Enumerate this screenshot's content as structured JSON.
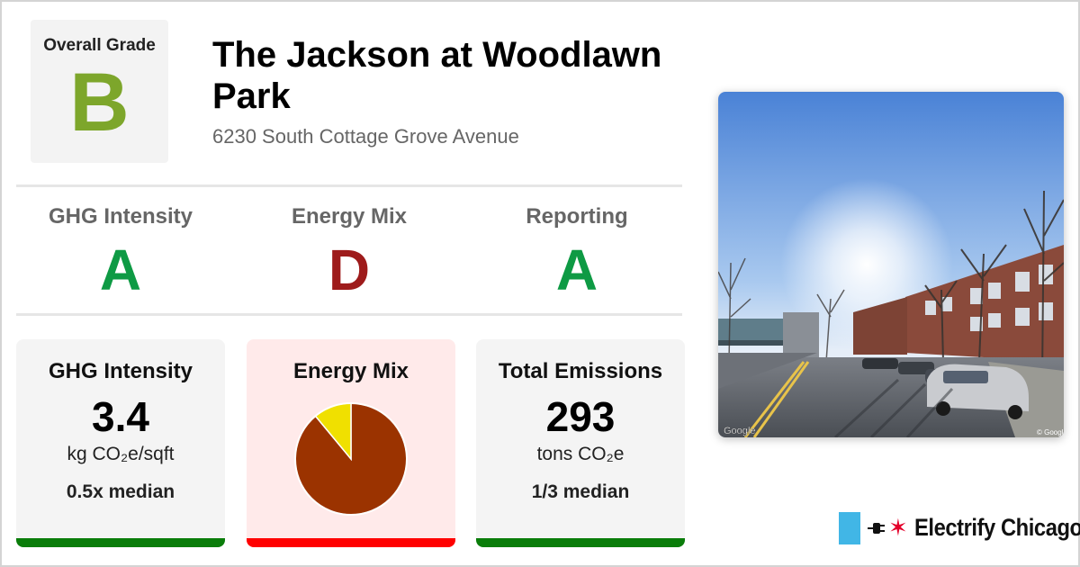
{
  "overall": {
    "label": "Overall Grade",
    "grade": "B",
    "color": "#7da62b"
  },
  "building": {
    "name": "The Jackson at Woodlawn Park",
    "address": "6230 South Cottage Grove Avenue"
  },
  "grades": [
    {
      "label": "GHG Intensity",
      "grade": "A",
      "color": "#0e9a44"
    },
    {
      "label": "Energy Mix",
      "grade": "D",
      "color": "#9e1b1b"
    },
    {
      "label": "Reporting",
      "grade": "A",
      "color": "#0e9a44"
    }
  ],
  "cards": {
    "ghg": {
      "title": "GHG Intensity",
      "value": "3.4",
      "unit": "kg CO₂e/sqft",
      "median": "0.5x median",
      "bar_color": "#0a7d0a"
    },
    "mix": {
      "title": "Energy Mix",
      "bar_color": "#ff0000"
    },
    "emissions": {
      "title": "Total Emissions",
      "value": "293",
      "unit": "tons CO₂e",
      "median": "1/3 median",
      "bar_color": "#0a7d0a"
    }
  },
  "chart_data": {
    "type": "pie",
    "title": "Energy Mix",
    "slices": [
      {
        "value": 0.89,
        "color": "#9b3300"
      },
      {
        "value": 0.11,
        "color": "#f0e000"
      }
    ]
  },
  "photo": {
    "watermark_left": "Google",
    "watermark_right": "© Google"
  },
  "brand": {
    "name": "Electrify Chicago",
    "accent": "#41b6e6",
    "star_color": "#e4002b"
  }
}
